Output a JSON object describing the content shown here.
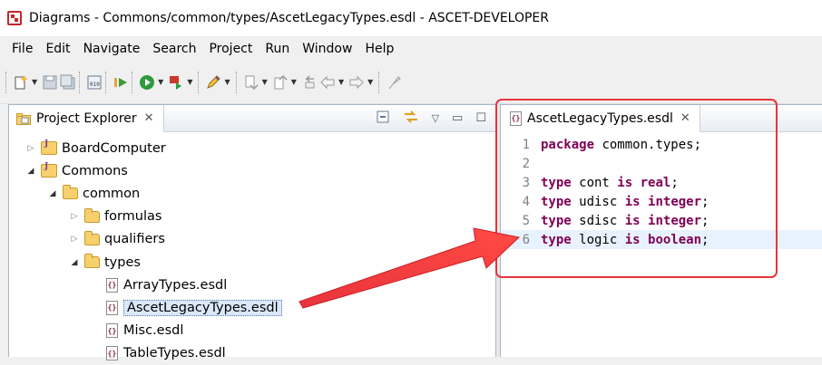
{
  "window": {
    "title": "Diagrams - Commons/common/types/AscetLegacyTypes.esdl - ASCET-DEVELOPER"
  },
  "menu": [
    "File",
    "Edit",
    "Navigate",
    "Search",
    "Project",
    "Run",
    "Window",
    "Help"
  ],
  "toolbar": {
    "icons": [
      "new-icon",
      "save-icon",
      "save-all-icon",
      "binary-icon",
      "debug-step-icon",
      "run-icon",
      "external-tool-icon",
      "pen-icon",
      "next-annotation-icon",
      "prev-annotation-icon",
      "last-edit-icon",
      "back-icon",
      "forward-icon",
      "pin-icon"
    ]
  },
  "explorer": {
    "title": "Project Explorer",
    "tree": [
      {
        "label": "BoardComputer",
        "kind": "project",
        "depth": 0,
        "expanded": false
      },
      {
        "label": "Commons",
        "kind": "project",
        "depth": 0,
        "expanded": true
      },
      {
        "label": "common",
        "kind": "folder",
        "depth": 1,
        "expanded": true
      },
      {
        "label": "formulas",
        "kind": "folder",
        "depth": 2,
        "expanded": false
      },
      {
        "label": "qualifiers",
        "kind": "folder",
        "depth": 2,
        "expanded": false
      },
      {
        "label": "types",
        "kind": "folder",
        "depth": 2,
        "expanded": true
      },
      {
        "label": "ArrayTypes.esdl",
        "kind": "file",
        "depth": 3
      },
      {
        "label": "AscetLegacyTypes.esdl",
        "kind": "file",
        "depth": 3,
        "selected": true
      },
      {
        "label": "Misc.esdl",
        "kind": "file",
        "depth": 3
      },
      {
        "label": "TableTypes.esdl",
        "kind": "file",
        "depth": 3
      }
    ]
  },
  "editor": {
    "tab_title": "AscetLegacyTypes.esdl",
    "lines": [
      {
        "n": "1",
        "tokens": [
          {
            "t": "package",
            "k": "kw"
          },
          {
            "t": " common.types;",
            "k": "tx"
          }
        ]
      },
      {
        "n": "2",
        "tokens": []
      },
      {
        "n": "3",
        "tokens": [
          {
            "t": "type",
            "k": "kw"
          },
          {
            "t": " cont ",
            "k": "tx"
          },
          {
            "t": "is",
            "k": "kw"
          },
          {
            "t": " ",
            "k": "tx"
          },
          {
            "t": "real",
            "k": "kw"
          },
          {
            "t": ";",
            "k": "tx"
          }
        ]
      },
      {
        "n": "4",
        "tokens": [
          {
            "t": "type",
            "k": "kw"
          },
          {
            "t": " udisc ",
            "k": "tx"
          },
          {
            "t": "is",
            "k": "kw"
          },
          {
            "t": " ",
            "k": "tx"
          },
          {
            "t": "integer",
            "k": "kw"
          },
          {
            "t": ";",
            "k": "tx"
          }
        ]
      },
      {
        "n": "5",
        "tokens": [
          {
            "t": "type",
            "k": "kw"
          },
          {
            "t": " sdisc ",
            "k": "tx"
          },
          {
            "t": "is",
            "k": "kw"
          },
          {
            "t": " ",
            "k": "tx"
          },
          {
            "t": "integer",
            "k": "kw"
          },
          {
            "t": ";",
            "k": "tx"
          }
        ]
      },
      {
        "n": "6",
        "tokens": [
          {
            "t": "type",
            "k": "kw"
          },
          {
            "t": " logic ",
            "k": "tx"
          },
          {
            "t": "is",
            "k": "kw"
          },
          {
            "t": " ",
            "k": "tx"
          },
          {
            "t": "boolean",
            "k": "kw"
          },
          {
            "t": ";",
            "k": "tx"
          }
        ],
        "current": true
      }
    ]
  },
  "colors": {
    "annotation": "#e8343b",
    "keyword": "#7f0055",
    "selection": "#dbe8f9"
  }
}
